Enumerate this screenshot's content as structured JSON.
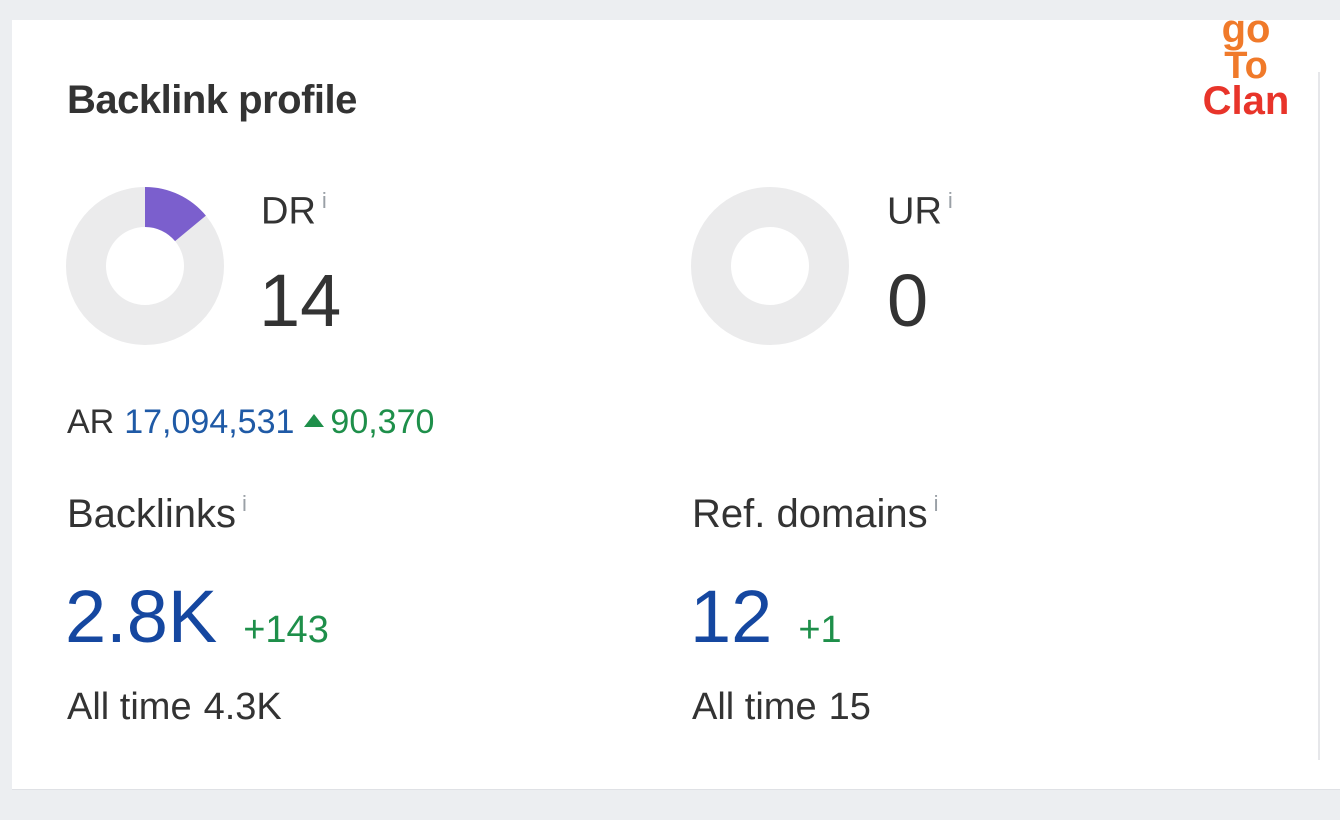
{
  "card": {
    "title": "Backlink profile"
  },
  "logo": {
    "text_lines": [
      "go",
      "To",
      "Clan"
    ],
    "colors": {
      "top": "#f07a2a",
      "bottom": "#e8342a"
    }
  },
  "dr": {
    "label": "DR",
    "info_icon": "i",
    "value": "14",
    "gauge_fraction": 0.14,
    "gauge_color": "#7b5fcd",
    "track_color": "#ebebec"
  },
  "ur": {
    "label": "UR",
    "info_icon": "i",
    "value": "0",
    "gauge_fraction": 0,
    "track_color": "#ebebec"
  },
  "ar": {
    "label": "AR",
    "value": "17,094,531",
    "delta": "90,370",
    "delta_icon": "up-triangle-icon"
  },
  "backlinks": {
    "label": "Backlinks",
    "info_icon": "i",
    "value": "2.8K",
    "delta": "+143",
    "alltime_label": "All time",
    "alltime_value": "4.3K"
  },
  "ref_domains": {
    "label": "Ref. domains",
    "info_icon": "i",
    "value": "12",
    "delta": "+1",
    "alltime_label": "All time",
    "alltime_value": "15"
  },
  "colors": {
    "link_blue": "#1547a0",
    "ar_blue": "#1f5aa6",
    "positive_green": "#1e8f4a",
    "text": "#333333"
  }
}
